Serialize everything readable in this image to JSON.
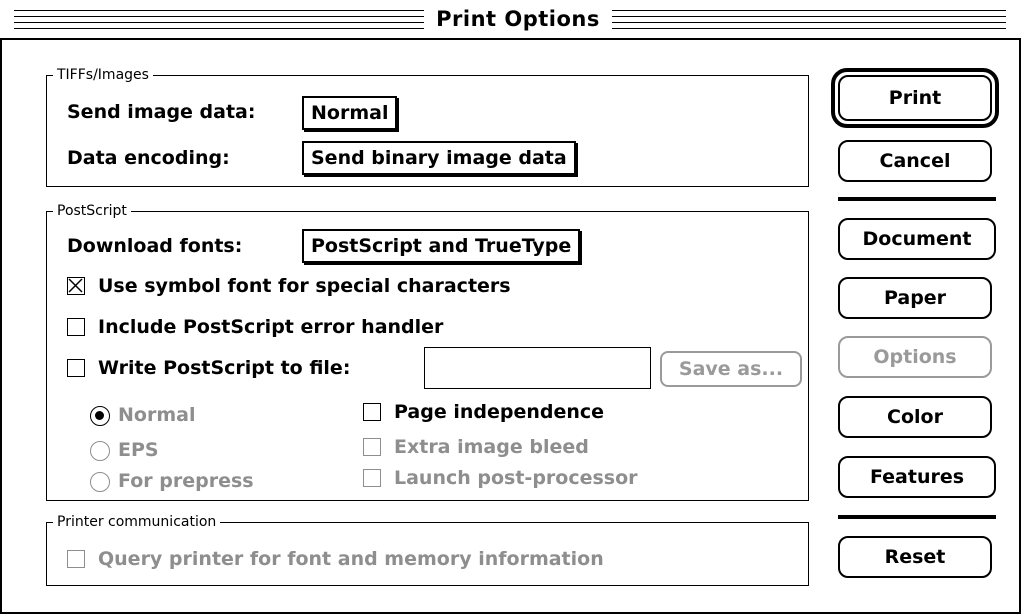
{
  "window": {
    "title": "Print Options"
  },
  "tiffs_group": {
    "label": "TIFFs/Images",
    "send_image_data": {
      "label": "Send image data:",
      "value": "Normal"
    },
    "data_encoding": {
      "label": "Data encoding:",
      "value": "Send binary image data"
    }
  },
  "postscript_group": {
    "label": "PostScript",
    "download_fonts": {
      "label": "Download fonts:",
      "value": "PostScript and TrueType"
    },
    "use_symbol_font": {
      "label": "Use symbol font for special characters",
      "checked": true
    },
    "include_error_handler": {
      "label": "Include PostScript error handler",
      "checked": false
    },
    "write_to_file": {
      "label": "Write PostScript to file:",
      "checked": false,
      "filename": ""
    },
    "save_as_label": "Save as...",
    "radios": [
      {
        "label": "Normal",
        "selected": true
      },
      {
        "label": "EPS",
        "selected": false
      },
      {
        "label": "For prepress",
        "selected": false
      }
    ],
    "page_independence": {
      "label": "Page independence",
      "checked": false
    },
    "extra_image_bleed": {
      "label": "Extra image bleed",
      "checked": false
    },
    "launch_post_processor": {
      "label": "Launch post-processor",
      "checked": false
    }
  },
  "printer_comm_group": {
    "label": "Printer communication",
    "query_printer": {
      "label": "Query printer for font and memory information",
      "checked": false
    }
  },
  "buttons": {
    "print": "Print",
    "cancel": "Cancel",
    "document": "Document",
    "paper": "Paper",
    "options": "Options",
    "color": "Color",
    "features": "Features",
    "reset": "Reset"
  },
  "colors": {
    "disabled": "#8e8e8e",
    "foreground": "#000000",
    "background": "#ffffff"
  }
}
